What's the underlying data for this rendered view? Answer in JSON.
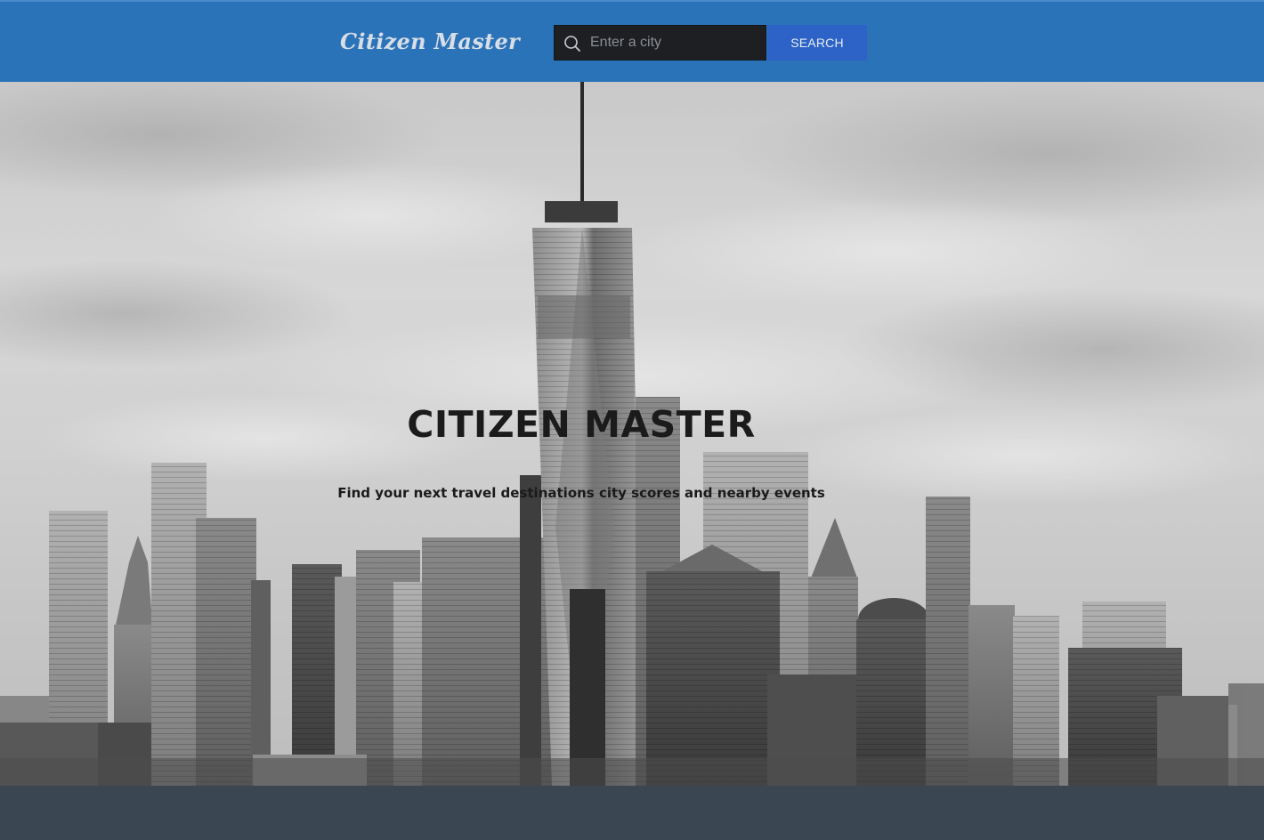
{
  "header": {
    "brand": "Citizen Master",
    "search_placeholder": "Enter a city",
    "search_value": "",
    "search_button_label": "SEARCH"
  },
  "hero": {
    "title": "CITIZEN MASTER",
    "subtitle": "Find your next travel destinations city scores and nearby events",
    "image_description_icon": "city-skyline-image"
  },
  "colors": {
    "header_bg": "#2b73b8",
    "search_bg": "#1d1f23",
    "search_button_bg": "#2d62c6",
    "footer_bg": "#3a4651"
  }
}
